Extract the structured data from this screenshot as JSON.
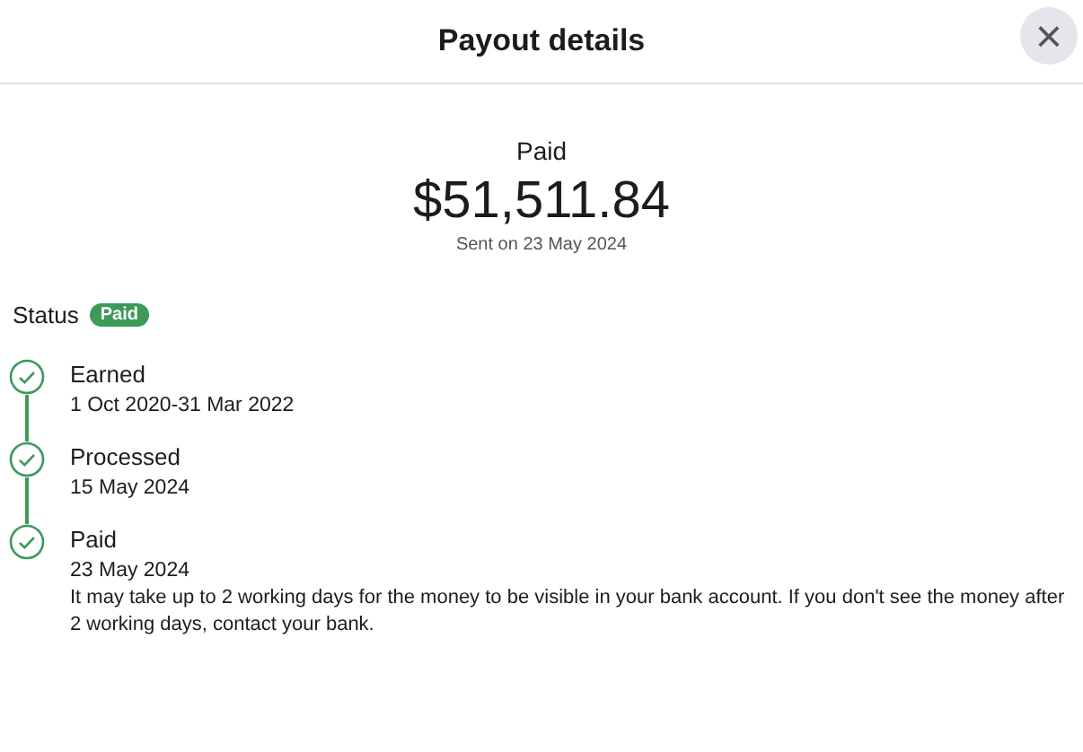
{
  "dialog": {
    "title": "Payout details",
    "close_icon": "×"
  },
  "summary": {
    "label": "Paid",
    "amount": "$51,511.84",
    "sent": "Sent on 23 May 2024"
  },
  "status": {
    "label": "Status",
    "badge": "Paid"
  },
  "timeline": [
    {
      "title": "Earned",
      "date": "1 Oct 2020-31 Mar 2022"
    },
    {
      "title": "Processed",
      "date": "15 May 2024"
    },
    {
      "title": "Paid",
      "date": "23 May 2024",
      "note": "It may take up to 2 working days for the money to be visible in your bank account. If you don't see the money after 2 working days, contact your bank."
    }
  ]
}
